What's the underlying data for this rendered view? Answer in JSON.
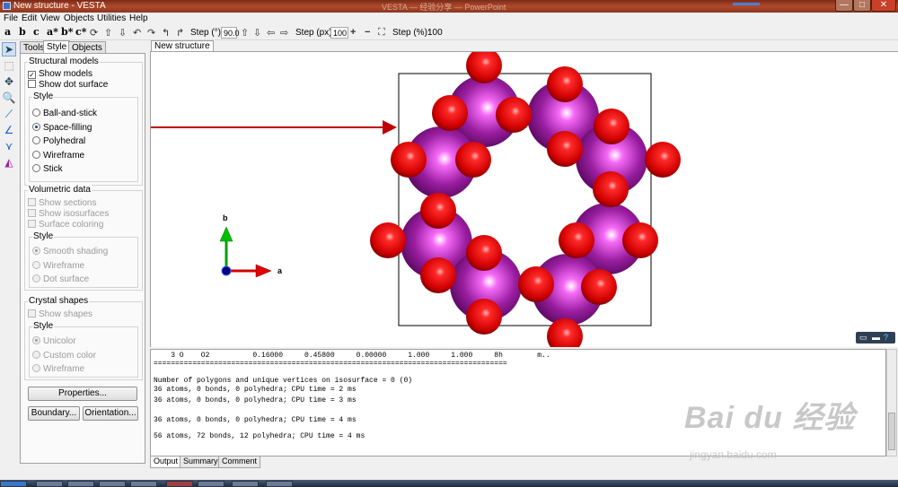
{
  "window": {
    "title": "New structure - VESTA",
    "faint_background_title": "VESTA — 经验分享 — PowerPoint",
    "buttons": {
      "minimize": "—",
      "maximize": "□",
      "close": "✕"
    }
  },
  "menu": [
    "File",
    "Edit",
    "View",
    "Objects",
    "Utilities",
    "Help"
  ],
  "toolbar": {
    "axis_buttons": [
      "a",
      "b",
      "c",
      "a*",
      "b*",
      "c*"
    ],
    "step_deg_label": "Step (°):",
    "step_deg_value": "90.0",
    "step_px_label": "Step (px):",
    "step_px_value": "100",
    "step_pct_label": "Step (%):",
    "step_pct_value": "100",
    "icons": [
      "rotate-icon",
      "arrow-up-icon",
      "arrow-down-icon",
      "rotate-left-icon",
      "rotate-right-icon",
      "turn-left-icon",
      "turn-right-icon",
      "arrow-up-icon",
      "arrow-down-icon",
      "arrow-left-icon",
      "arrow-right-icon",
      "plus-icon",
      "minus-icon",
      "fit-icon"
    ]
  },
  "left_icons": [
    "select-arrow-icon",
    "select-region-icon",
    "translate-icon",
    "zoom-icon",
    "distance-icon",
    "angle-icon",
    "dihedral-icon",
    "info-icon"
  ],
  "panel": {
    "tabs": [
      "Tools",
      "Style",
      "Objects"
    ],
    "active_tab": "Style",
    "structural": {
      "title": "Structural models",
      "show_models": "Show models",
      "show_dot_surface": "Show dot surface",
      "style_title": "Style",
      "options": [
        "Ball-and-stick",
        "Space-filling",
        "Polyhedral",
        "Wireframe",
        "Stick"
      ],
      "selected": "Space-filling"
    },
    "volumetric": {
      "title": "Volumetric data",
      "show_sections": "Show sections",
      "show_isosurfaces": "Show isosurfaces",
      "surface_coloring": "Surface coloring",
      "style_title": "Style",
      "options": [
        "Smooth shading",
        "Wireframe",
        "Dot surface"
      ],
      "selected": "Smooth shading"
    },
    "crystal": {
      "title": "Crystal shapes",
      "show_shapes": "Show shapes",
      "style_title": "Style",
      "options": [
        "Unicolor",
        "Custom color",
        "Wireframe"
      ],
      "selected": "Unicolor"
    },
    "buttons": {
      "properties": "Properties...",
      "boundary": "Boundary...",
      "orientation": "Orientation..."
    }
  },
  "viewport": {
    "tab": "New structure",
    "axis_a": "a",
    "axis_b": "b",
    "colors": {
      "atom_large": "#9a1ea0",
      "atom_small": "#e01010",
      "axis_a": "#d00000",
      "axis_b": "#00a000",
      "axis_c": "#0000a0",
      "annotation_arrow": "#c00000"
    }
  },
  "output": {
    "lines": [
      "    3 O    O2          0.16000     0.45800     0.00000     1.000     1.000     8h        m..",
      "==================================================================================",
      "",
      "Number of polygons and unique vertices on isosurface = 0 (0)",
      "36 atoms, 0 bonds, 0 polyhedra; CPU time = 2 ms",
      "",
      "36 atoms, 0 bonds, 0 polyhedra; CPU time = 4 ms",
      "",
      "36 atoms, 0 bonds, 0 polyhedra; CPU time = 3 ms",
      "",
      "56 atoms, 72 bonds, 12 polyhedra; CPU time = 4 ms"
    ],
    "tabs": [
      "Output",
      "Summary",
      "Comment"
    ],
    "active_tab": "Output"
  },
  "watermark": {
    "logo": "Bai du 经验",
    "url": "jingyan.baidu.com"
  }
}
